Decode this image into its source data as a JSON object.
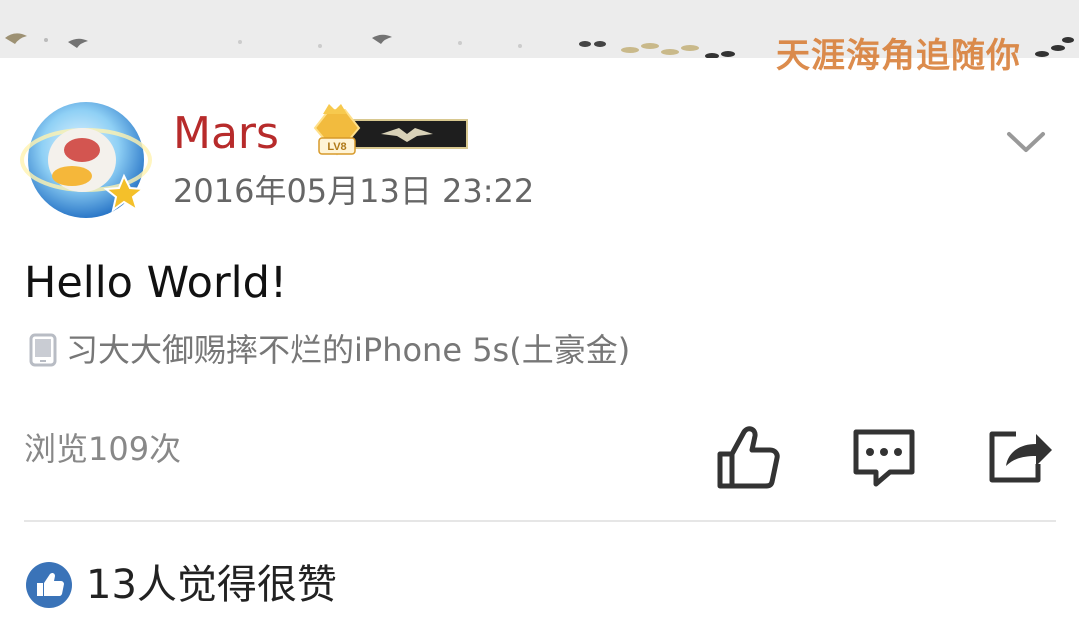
{
  "banner": {
    "text": "天涯海角追随你"
  },
  "post": {
    "username": "Mars",
    "level_badge": "LV8",
    "timestamp": "2016年05月13日 23:22",
    "content": "Hello World!",
    "device": "习大大御赐摔不烂的iPhone 5s(土豪金)",
    "views": "浏览109次",
    "likes_summary": "13人觉得很赞"
  },
  "icons": {
    "collapse": "chevron-down-icon",
    "device": "phone-icon",
    "like": "thumbs-up-icon",
    "comment": "comment-icon",
    "share": "share-icon",
    "likes_summary": "thumbs-up-circle-icon"
  },
  "colors": {
    "username": "#b72b2b",
    "accent_blue": "#3a73b8",
    "badge_gold": "#f0b43a",
    "banner_text": "#d9803a"
  }
}
